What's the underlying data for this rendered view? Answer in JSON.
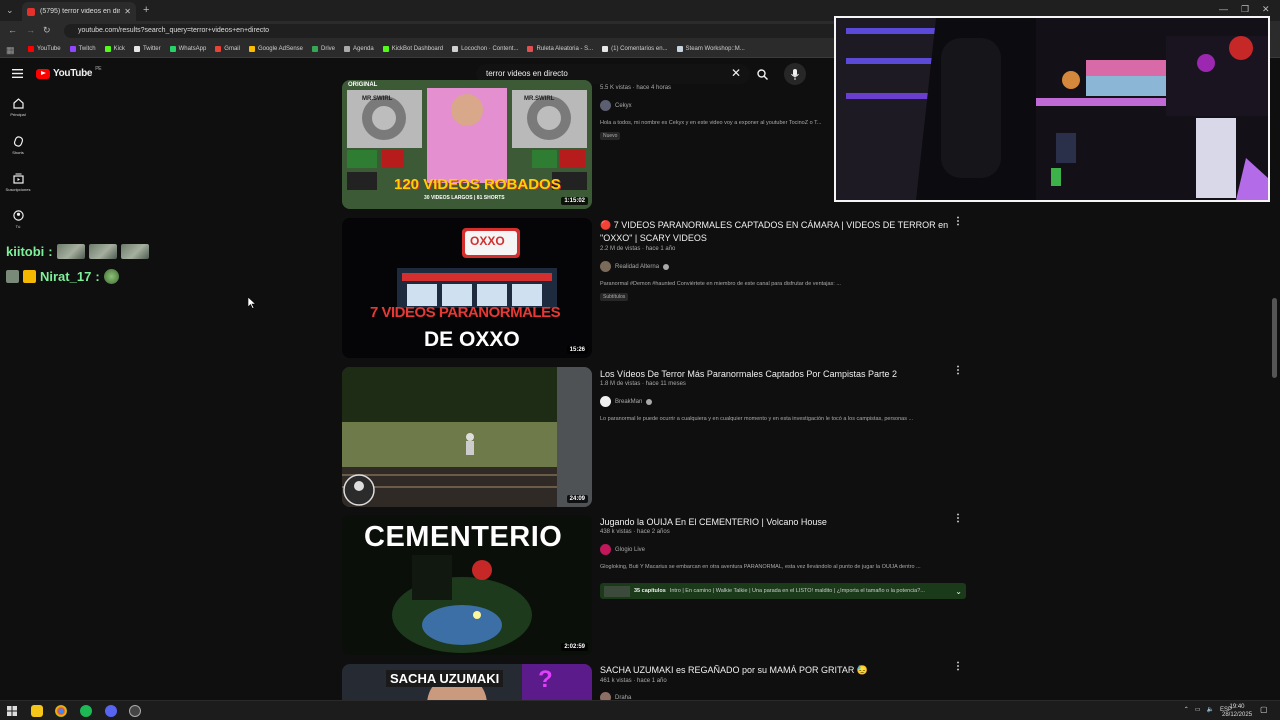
{
  "browser": {
    "tab_title": "(5795) terror videos en directo",
    "url": "youtube.com/results?search_query=terror+videos+en+directo",
    "bookmarks": [
      {
        "label": "YouTube",
        "color": "#ff0000"
      },
      {
        "label": "Twitch",
        "color": "#9146ff"
      },
      {
        "label": "Kick",
        "color": "#53fc18"
      },
      {
        "label": "Twitter",
        "color": "#e7e7e7"
      },
      {
        "label": "WhatsApp",
        "color": "#25d366"
      },
      {
        "label": "Gmail",
        "color": "#ea4335"
      },
      {
        "label": "Google AdSense",
        "color": "#fbbc04"
      },
      {
        "label": "Drive",
        "color": "#34a853"
      },
      {
        "label": "Agenda",
        "color": "#aaaaaa"
      },
      {
        "label": "KickBot Dashboard",
        "color": "#53fc18"
      },
      {
        "label": "Locochon · Content...",
        "color": "#d0d0d0"
      },
      {
        "label": "Ruleta Aleatoria - S...",
        "color": "#e05050"
      },
      {
        "label": "(1) Comentarios en...",
        "color": "#e7e7e7"
      },
      {
        "label": "Steam Workshop::M...",
        "color": "#c7d5e0"
      }
    ]
  },
  "youtube": {
    "logo_text": "YouTube",
    "region": "PE",
    "search_value": "terror videos en directo"
  },
  "rail": [
    {
      "label": "Principal",
      "icon": "home-icon"
    },
    {
      "label": "Shorts",
      "icon": "shorts-icon"
    },
    {
      "label": "Suscripciones",
      "icon": "subscriptions-icon"
    },
    {
      "label": "Tú",
      "icon": "you-icon"
    }
  ],
  "chat": [
    {
      "user": "kiitobi",
      "sep": ":"
    },
    {
      "user": "Nirat_17",
      "sep": ":"
    }
  ],
  "results": [
    {
      "title": "",
      "meta": "5.5 K vistas · hace 4 horas",
      "channel": "Cekyx",
      "desc": "Hola a todos, mi nombre es Cekyx y en este video voy a exponer al youtuber TocinoZ o T...",
      "badge": "Nuevo",
      "duration": "1:15:02",
      "thumb_text": "120 VIDEOS ROBADOS",
      "thumb_sub": "30 VIDEOS LARGOS | 81 SHORTS",
      "thumb_side": "MR.SWIRL",
      "thumb_top": "ORIGINAL"
    },
    {
      "title": "🔴 7 VIDEOS PARANORMALES CAPTADOS EN CÁMARA | VIDEOS DE TERROR en \"OXXO\" | SCARY VIDEOS",
      "meta": "2.2 M de vistas · hace 1 año",
      "channel": "Realidad Alterna",
      "desc": "Paranormal #Demon #haunted Conviértete en miembro de este canal para disfrutar de ventajas: ...",
      "badge": "Subtítulos",
      "duration": "15:26",
      "thumb_text": "7 VIDEOS PARANORMALES",
      "thumb_sub": "DE OXXO",
      "thumb_sign": "OXXO"
    },
    {
      "title": "Los Vídeos De Terror Más Paranormales Captados Por Campistas Parte 2",
      "meta": "1.8 M de vistas · hace 11 meses",
      "channel": "BreakMan",
      "desc": "Lo paranormal le puede ocurrir a cualquiera y en cualquier momento y en esta investigación le tocó a los campistas, personas ...",
      "duration": "24:09"
    },
    {
      "title": "Jugando la OUIJA En El CEMENTERIO | Volcano House",
      "meta": "438 k vistas · hace 2 años",
      "channel": "Glogio Live",
      "desc": "Glogloking, Buti Y Macarius se embarcan en otra aventura PARANORMAL, esta vez llevándolo al punto de jugar la OUIJA dentro ...",
      "duration": "2:02:59",
      "thumb_text": "CEMENTERIO",
      "chapters_count": "35 capítulos",
      "chapters_text": "Intro | En camino | Walkie Talkie | Una parada en el LISTO! maldito | ¿Importa el tamaño o la potencia?..."
    },
    {
      "title": "SACHA UZUMAKI es REGAÑADO por su MAMÁ POR GRITAR 😓",
      "meta": "461 k vistas · hace 1 año",
      "channel": "Draha",
      "thumb_text": "SACHA UZUMAKI"
    }
  ],
  "taskbar": {
    "lang": "ESP",
    "time": "19:40",
    "date": "28/12/2025"
  }
}
